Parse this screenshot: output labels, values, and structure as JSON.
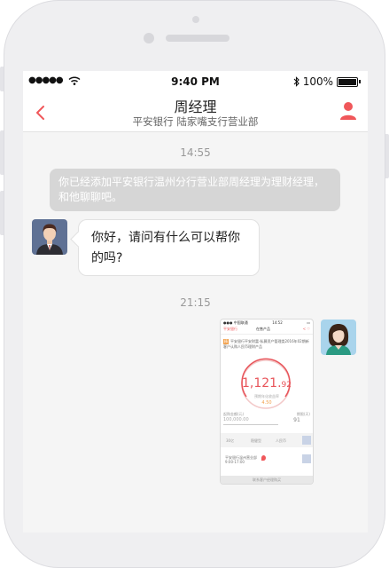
{
  "status_bar": {
    "time": "9:40 PM",
    "battery": "100%"
  },
  "header": {
    "title": "周经理",
    "subtitle": "平安银行 陆家嘴支行营业部"
  },
  "chat": {
    "timestamp_1": "14:55",
    "system_message": "你已经添加平安银行温州分行营业部周经理为理财经理，和他聊聊吧。",
    "incoming_message": "你好，请问有什么可以帮你的吗?",
    "timestamp_2": "21:15"
  },
  "shared_screenshot": {
    "status_left": "●●● 中国联通",
    "status_time": "14:52",
    "back_label": "平安银行",
    "title": "在售产品",
    "badge": "精",
    "product_name": "平安银行平安财富-私募资产管理类2016年02期新客户认购人民币理财产品",
    "amount_main": "1,121.",
    "amount_decimal": "92",
    "rate_label": "预期年化收益率",
    "rate": "4.50",
    "label_left": "起购金额(元)",
    "label_right": "期限(天)",
    "input_value": "100,000.00",
    "count_value": "91",
    "strip_item_1": "30亿",
    "strip_item_2": "稳健型",
    "strip_item_3": "人民币",
    "branch_line_1": "平安银行温州营业部",
    "branch_line_2": "9:00-17:00",
    "footer": "联系客户经理购买"
  },
  "colors": {
    "accent": "#f0575a",
    "system_bubble": "#d6d6d6",
    "chat_background": "#f5f5f5"
  }
}
